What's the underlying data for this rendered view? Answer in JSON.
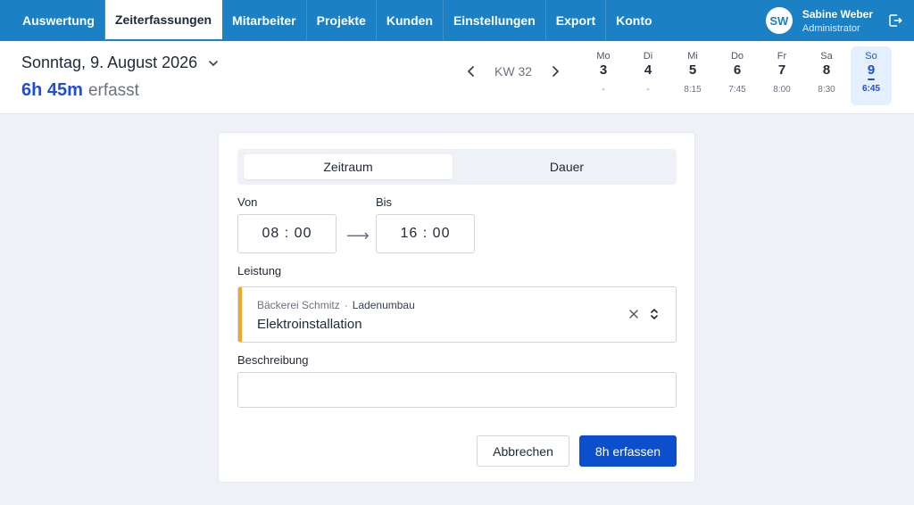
{
  "nav": {
    "tabs": [
      {
        "label": "Auswertung",
        "active": false
      },
      {
        "label": "Zeiterfassungen",
        "active": true
      },
      {
        "label": "Mitarbeiter",
        "active": false
      },
      {
        "label": "Projekte",
        "active": false
      },
      {
        "label": "Kunden",
        "active": false
      },
      {
        "label": "Einstellungen",
        "active": false
      },
      {
        "label": "Export",
        "active": false
      },
      {
        "label": "Konto",
        "active": false
      }
    ],
    "user": {
      "initials": "SW",
      "name": "Sabine Weber",
      "role": "Administrator"
    }
  },
  "header": {
    "date": "Sonntag, 9. August 2026",
    "total_value": "6h 45m",
    "total_suffix": "erfasst",
    "week_label": "KW 32",
    "days": [
      {
        "name": "Mo",
        "num": "3",
        "value": "-"
      },
      {
        "name": "Di",
        "num": "4",
        "value": "-"
      },
      {
        "name": "Mi",
        "num": "5",
        "value": "8:15"
      },
      {
        "name": "Do",
        "num": "6",
        "value": "7:45"
      },
      {
        "name": "Fr",
        "num": "7",
        "value": "8:00"
      },
      {
        "name": "Sa",
        "num": "8",
        "value": "8:30"
      },
      {
        "name": "So",
        "num": "9",
        "value": "6:45",
        "active": true
      }
    ]
  },
  "form": {
    "mode_tabs": [
      "Zeitraum",
      "Dauer"
    ],
    "active_mode": "Zeitraum",
    "from_label": "Von",
    "from_value": "08 : 00",
    "to_label": "Bis",
    "to_value": "16 : 00",
    "service_label": "Leistung",
    "service": {
      "client": "Bäckerei Schmitz",
      "separator": "·",
      "project": "Ladenumbau",
      "name": "Elektroinstallation",
      "color": "#f5a623"
    },
    "description_label": "Beschreibung",
    "description_value": "",
    "cancel_label": "Abbrechen",
    "submit_label": "8h erfassen"
  },
  "colors": {
    "nav_bg": "#1b81c4",
    "accent": "#1d4ed8",
    "primary_button": "#0b4fcf"
  }
}
